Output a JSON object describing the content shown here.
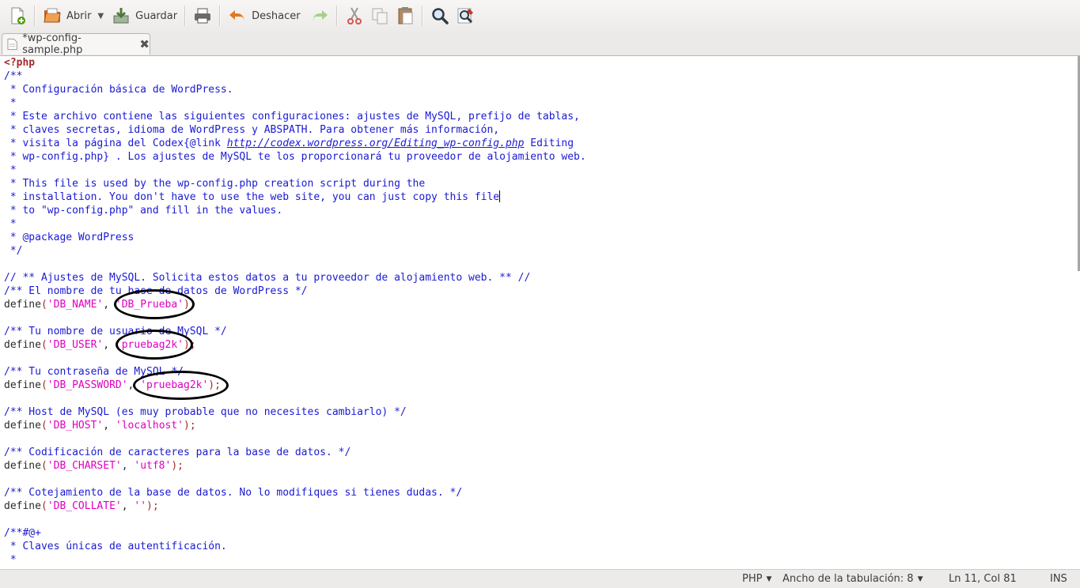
{
  "toolbar": {
    "open_label": "Abrir",
    "save_label": "Guardar",
    "undo_label": "Deshacer"
  },
  "tab": {
    "title": "*wp-config-sample.php"
  },
  "code_lines": [
    [
      [
        "kw",
        "<?php"
      ]
    ],
    [
      [
        "cm",
        "/**"
      ]
    ],
    [
      [
        "cm",
        " * Configuración básica de WordPress."
      ]
    ],
    [
      [
        "cm",
        " *"
      ]
    ],
    [
      [
        "cm",
        " * Este archivo contiene las siguientes configuraciones: ajustes de MySQL, prefijo de tablas,"
      ]
    ],
    [
      [
        "cm",
        " * claves secretas, idioma de WordPress y ABSPATH. Para obtener más información,"
      ]
    ],
    [
      [
        "cm",
        " * visita la página del Codex{@link "
      ],
      [
        "cm link",
        "http://codex.wordpress.org/Editing_wp-config.php"
      ],
      [
        "cm",
        " Editing"
      ]
    ],
    [
      [
        "cm",
        " * wp-config.php} . Los ajustes de MySQL te los proporcionará tu proveedor de alojamiento web."
      ]
    ],
    [
      [
        "cm",
        " *"
      ]
    ],
    [
      [
        "cm",
        " * This file is used by the wp-config.php creation script during the"
      ]
    ],
    [
      [
        "cm",
        " * installation. You don't have to use the web site, you can just copy this file"
      ],
      [
        "cursor",
        ""
      ]
    ],
    [
      [
        "cm",
        " * to \"wp-config.php\" and fill in the values."
      ]
    ],
    [
      [
        "cm",
        " *"
      ]
    ],
    [
      [
        "cm",
        " * @package WordPress"
      ]
    ],
    [
      [
        "cm",
        " */"
      ]
    ],
    [],
    [
      [
        "cm",
        "// ** Ajustes de MySQL. Solicita estos datos a tu proveedor de alojamiento web. ** //"
      ]
    ],
    [
      [
        "cm",
        "/** El nombre de tu base de datos de WordPress */"
      ]
    ],
    [
      [
        "fn",
        "define"
      ],
      [
        "punc",
        "("
      ],
      [
        "str",
        "'DB_NAME'"
      ],
      [
        "fn",
        ", "
      ],
      [
        "str",
        "'DB_Prueba'"
      ],
      [
        "punc",
        ");"
      ]
    ],
    [],
    [
      [
        "cm",
        "/** Tu nombre de usuario de MySQL */"
      ]
    ],
    [
      [
        "fn",
        "define"
      ],
      [
        "punc",
        "("
      ],
      [
        "str",
        "'DB_USER'"
      ],
      [
        "fn",
        ", "
      ],
      [
        "str",
        "'pruebag2k'"
      ],
      [
        "punc",
        ");"
      ]
    ],
    [],
    [
      [
        "cm",
        "/** Tu contraseña de MySQL */"
      ]
    ],
    [
      [
        "fn",
        "define"
      ],
      [
        "punc",
        "("
      ],
      [
        "str",
        "'DB_PASSWORD'"
      ],
      [
        "fn",
        ", "
      ],
      [
        "str",
        "'pruebag2k'"
      ],
      [
        "punc",
        ");"
      ]
    ],
    [],
    [
      [
        "cm",
        "/** Host de MySQL (es muy probable que no necesites cambiarlo) */"
      ]
    ],
    [
      [
        "fn",
        "define"
      ],
      [
        "punc",
        "("
      ],
      [
        "str",
        "'DB_HOST'"
      ],
      [
        "fn",
        ", "
      ],
      [
        "str",
        "'localhost'"
      ],
      [
        "punc",
        ");"
      ]
    ],
    [],
    [
      [
        "cm",
        "/** Codificación de caracteres para la base de datos. */"
      ]
    ],
    [
      [
        "fn",
        "define"
      ],
      [
        "punc",
        "("
      ],
      [
        "str",
        "'DB_CHARSET'"
      ],
      [
        "fn",
        ", "
      ],
      [
        "str",
        "'utf8'"
      ],
      [
        "punc",
        ");"
      ]
    ],
    [],
    [
      [
        "cm",
        "/** Cotejamiento de la base de datos. No lo modifiques si tienes dudas. */"
      ]
    ],
    [
      [
        "fn",
        "define"
      ],
      [
        "punc",
        "("
      ],
      [
        "str",
        "'DB_COLLATE'"
      ],
      [
        "fn",
        ", "
      ],
      [
        "str",
        "''"
      ],
      [
        "punc",
        ");"
      ]
    ],
    [],
    [
      [
        "cm",
        "/**#@+"
      ]
    ],
    [
      [
        "cm",
        " * Claves únicas de autentificación."
      ]
    ],
    [
      [
        "cm",
        " *"
      ]
    ]
  ],
  "status": {
    "language": "PHP",
    "tab_width": "Ancho de la tabulación: 8",
    "position": "Ln 11, Col 81",
    "mode": "INS"
  },
  "colors": {
    "comment": "#1a1ad4",
    "keyword": "#a52a2a",
    "string": "#e000c0",
    "annotation": "#000000"
  }
}
